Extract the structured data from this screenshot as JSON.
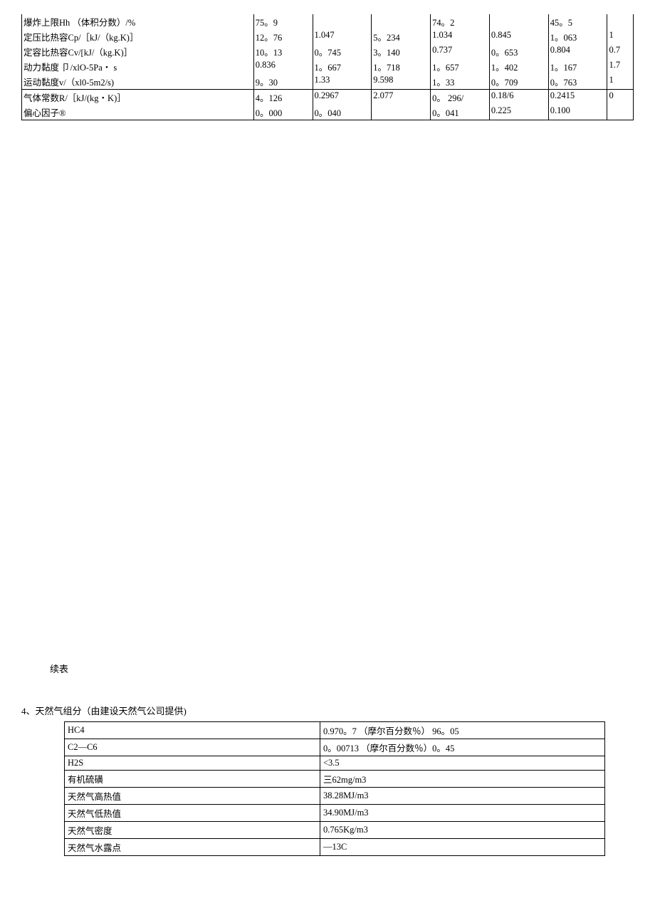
{
  "top_table": {
    "rows": [
      {
        "label": "爆炸上限Hh （体积分数）/%",
        "cells": [
          "75。9",
          "",
          "",
          "74。2",
          "",
          "45。5",
          ""
        ]
      },
      {
        "label": "定压比热容Cp/［kJ/（kg.K)］",
        "cells": [
          "12。76",
          "1.047",
          "5。234",
          "1.034",
          "0.845",
          "1。063",
          "1"
        ]
      },
      {
        "label": "定容比热容Cv/[kJ/（kg.K)］",
        "cells": [
          "10。13",
          "0。745",
          "3。140",
          "0.737",
          "0。653",
          "0.804",
          "0.7"
        ]
      },
      {
        "label": "动力黏度 卩/xlO-5Pa・ s",
        "cells": [
          "0.836",
          "1。667",
          "1。718",
          "1。657",
          "1。402",
          "1。167",
          "1.7"
        ]
      },
      {
        "label": "运动黏度v/（xl0-5m2/s)",
        "cells": [
          "9。30",
          "1.33",
          "9.598",
          "1。33",
          "0。709",
          "0。763",
          "1"
        ]
      },
      {
        "label": "气体常数R/［kJ/(kg・K)］",
        "cells": [
          "4。126",
          "0.2967",
          "2.077",
          "0。 296/",
          "0.18/6",
          "0.2415",
          "0"
        ]
      },
      {
        "label": "偏心因子®",
        "cells": [
          "0。000",
          "0。040",
          "",
          "0。041",
          "0.225",
          "0.100",
          ""
        ]
      }
    ]
  },
  "mid_label": "续表",
  "section_4_heading": "4、天然气组分（由建设天然气公司提供)",
  "gas_table": {
    "rows": [
      {
        "k": "HC4",
        "v": "0.970。7 （摩尔百分数％）  96。05"
      },
      {
        "k": "C2—C6",
        "v": "0。00713 （摩尔百分数％）0。45"
      },
      {
        "k": "H2S",
        "v": "<3.5"
      },
      {
        "k": "有机硫磺",
        "v": "三62mg/m3"
      },
      {
        "k": "天然气高热值",
        "v": "38.28MJ/m3"
      },
      {
        "k": "天然气低热值",
        "v": "34.90MJ/m3"
      },
      {
        "k": "天然气密度",
        "v": "0.765Kg/m3"
      },
      {
        "k": "天然气水露点",
        "v": "—13C"
      }
    ]
  }
}
